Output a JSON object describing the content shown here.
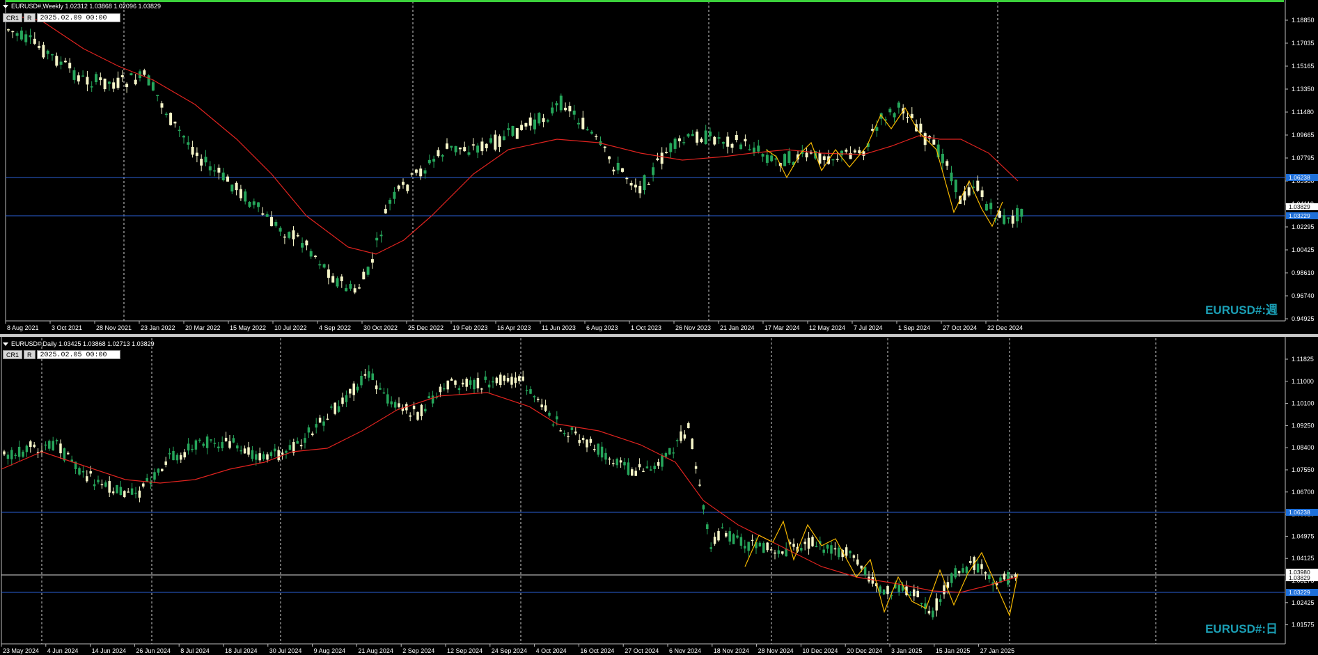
{
  "colors": {
    "background": "#000000",
    "bull_candle": "#26a65b",
    "bear_candle": "#f5f5c8",
    "moving_average": "#e0231f",
    "zigzag": "#f5b800",
    "horizontal_line": "#1e6fd9",
    "price_tag": "#1e6fd9",
    "watermark": "#1b9fb5"
  },
  "weekly": {
    "info": "EURUSD#,Weekly  1.02312 1.03868 1.02096 1.03829",
    "buttons": [
      "CR1",
      "R"
    ],
    "date_value": "2025.02.09 00:00",
    "watermark": "EURUSD#:週",
    "price_labels": [
      "1.18850",
      "1.17035",
      "1.15165",
      "1.13350",
      "1.11480",
      "1.09665",
      "1.07795",
      "1.05980",
      "1.04110",
      "1.02295",
      "1.00425",
      "0.98610",
      "0.96740",
      "0.94925"
    ],
    "price_tags": [
      "1.06238",
      "1.03829",
      "1.03229"
    ],
    "time_labels": [
      "8 Aug 2021",
      "3 Oct 2021",
      "28 Nov 2021",
      "23 Jan 2022",
      "20 Mar 2022",
      "15 May 2022",
      "10 Jul 2022",
      "4 Sep 2022",
      "30 Oct 2022",
      "25 Dec 2022",
      "19 Feb 2023",
      "16 Apr 2023",
      "11 Jun 2023",
      "6 Aug 2023",
      "1 Oct 2023",
      "26 Nov 2023",
      "21 Jan 2024",
      "17 Mar 2024",
      "12 May 2024",
      "7 Jul 2024",
      "1 Sep 2024",
      "27 Oct 2024",
      "22 Dec 2024"
    ]
  },
  "daily": {
    "info": "EURUSD#,Daily  1.03425 1.03868 1.02713 1.03829",
    "buttons": [
      "CR1",
      "R"
    ],
    "date_value": "2025.02.05 00:00",
    "watermark": "EURUSD#:日",
    "price_labels": [
      "1.11825",
      "1.11000",
      "1.10100",
      "1.09250",
      "1.08400",
      "1.07550",
      "1.06700",
      "1.05825",
      "1.04975",
      "1.04125",
      "1.03275",
      "1.02425",
      "1.01575"
    ],
    "price_tags": [
      "1.06238",
      "1.03980",
      "1.03829",
      "1.03229"
    ],
    "time_labels": [
      "23 May 2024",
      "4 Jun 2024",
      "14 Jun 2024",
      "26 Jun 2024",
      "8 Jul 2024",
      "18 Jul 2024",
      "30 Jul 2024",
      "9 Aug 2024",
      "21 Aug 2024",
      "2 Sep 2024",
      "12 Sep 2024",
      "24 Sep 2024",
      "4 Oct 2024",
      "16 Oct 2024",
      "27 Oct 2024",
      "6 Nov 2024",
      "18 Nov 2024",
      "28 Nov 2024",
      "10 Dec 2024",
      "20 Dec 2024",
      "3 Jan 2025",
      "15 Jan 2025",
      "27 Jan 2025"
    ]
  }
}
